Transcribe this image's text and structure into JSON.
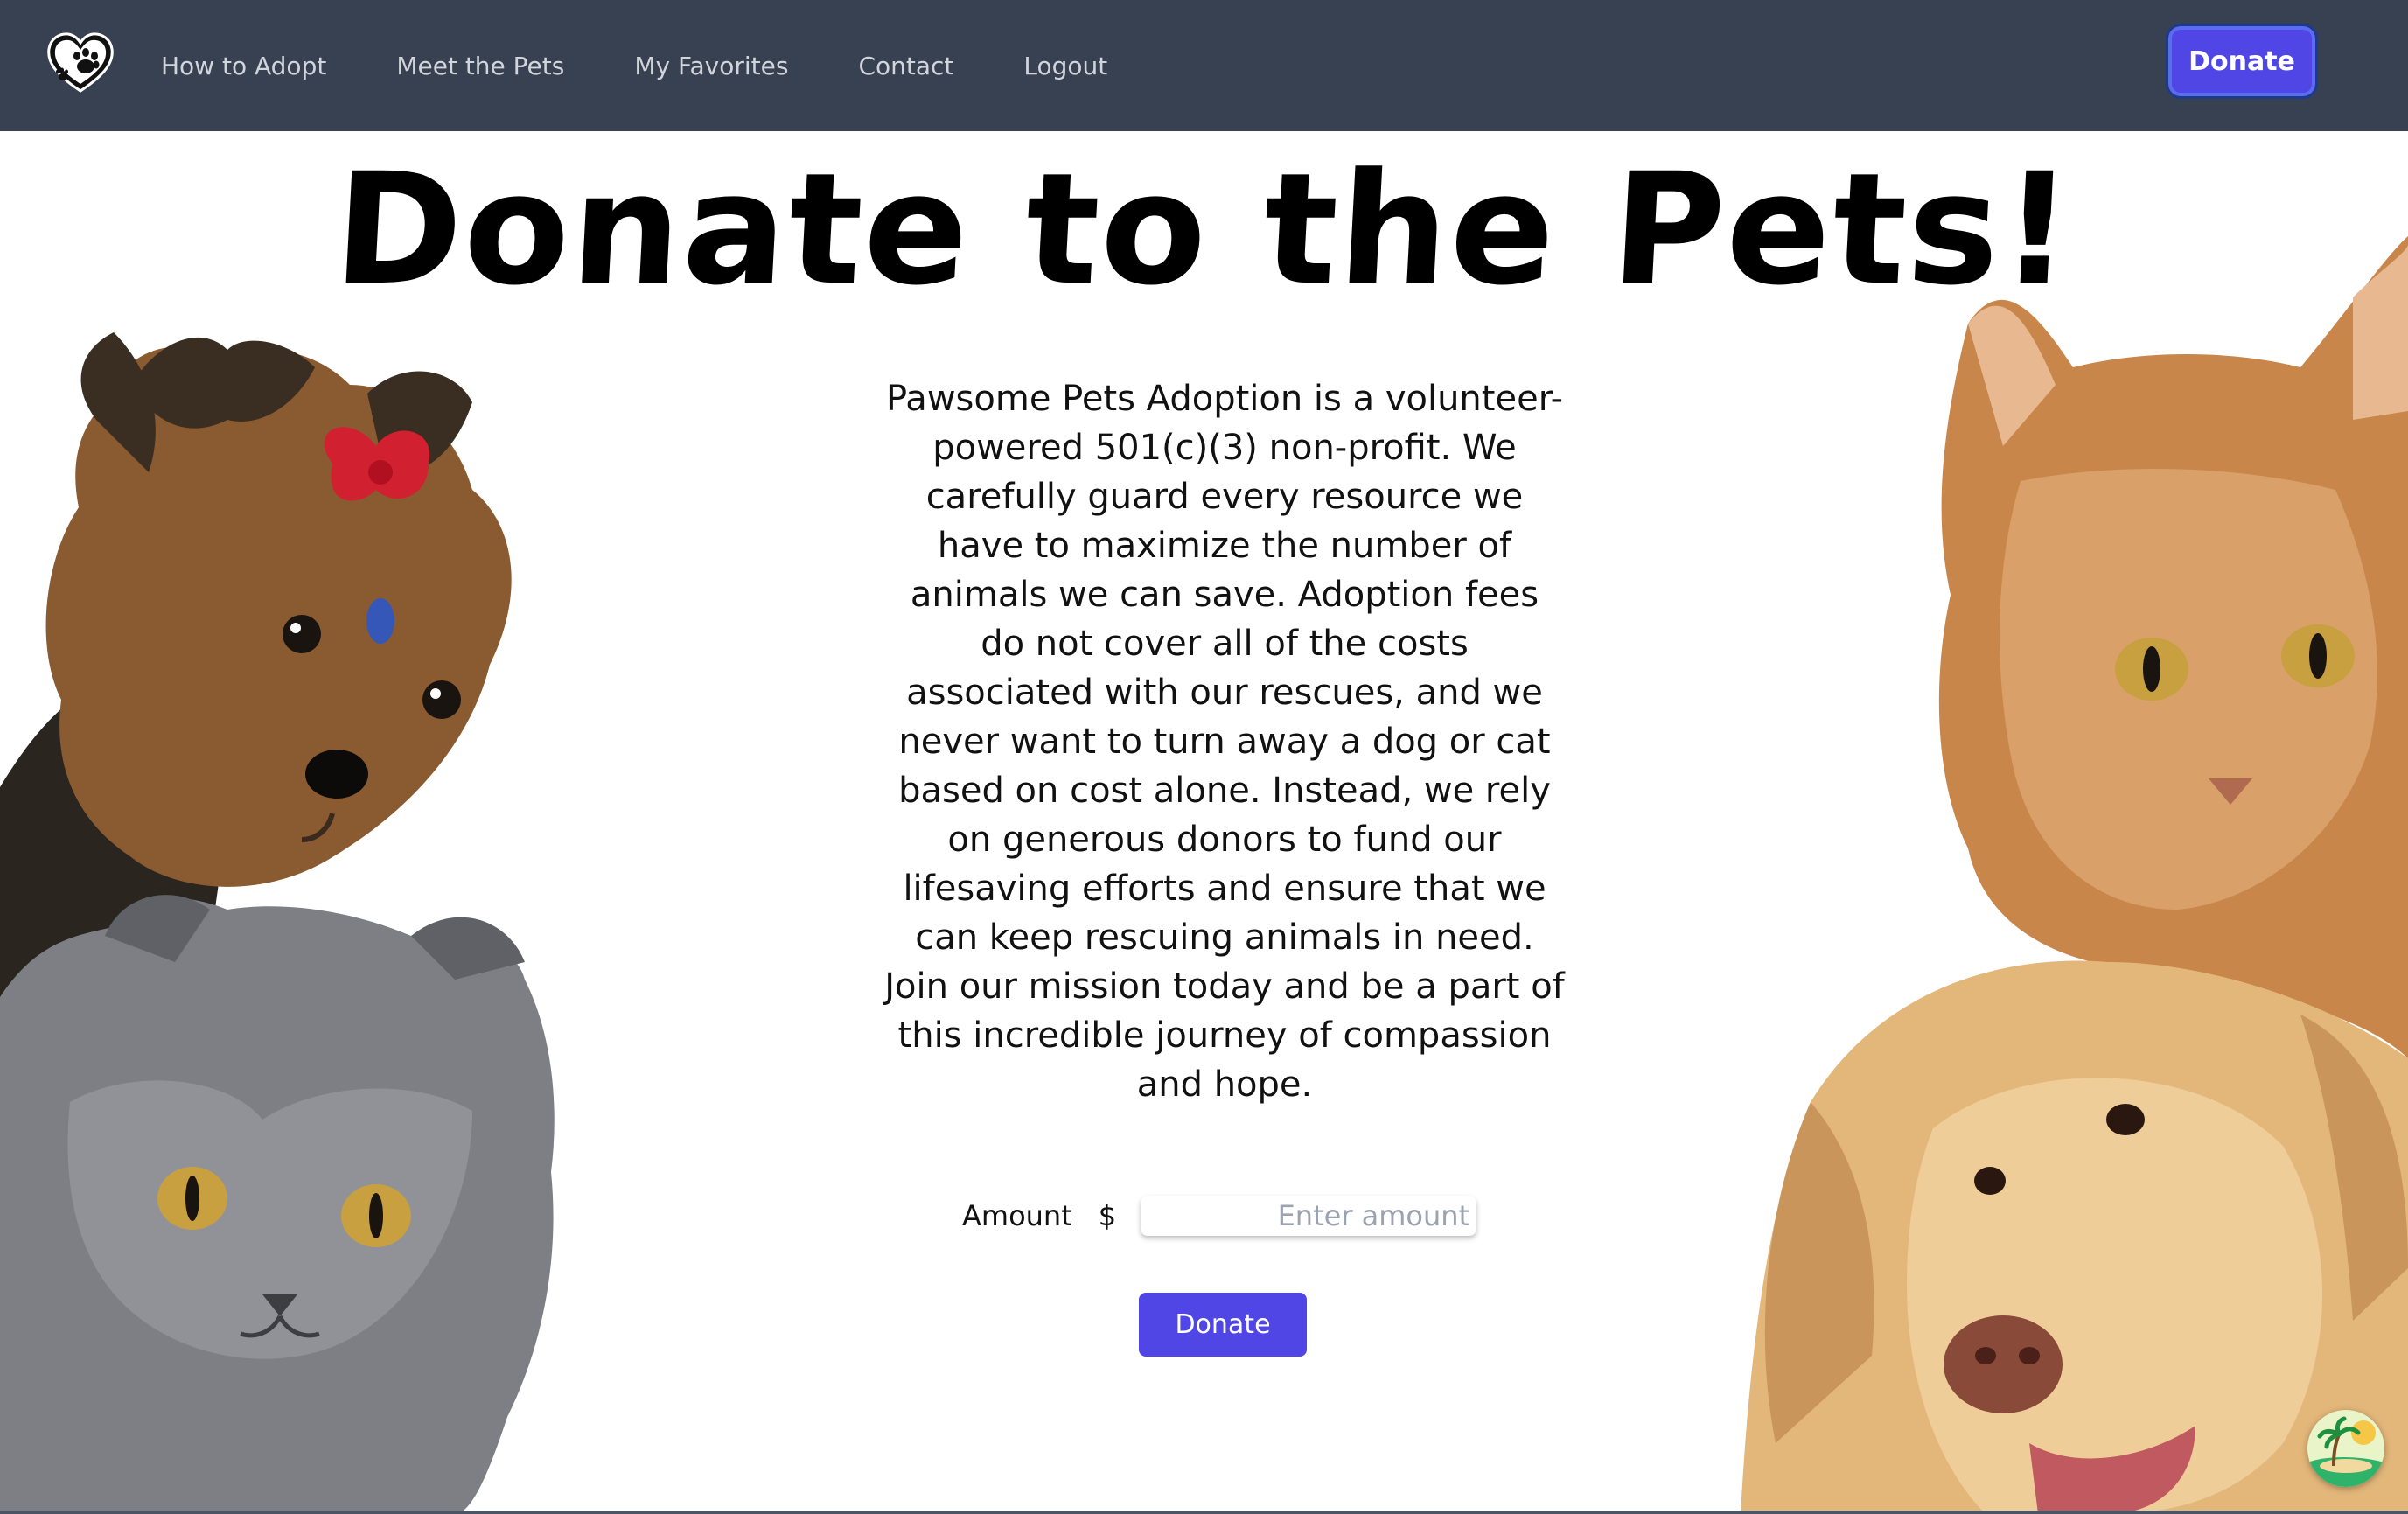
{
  "nav": {
    "logo_icon": "heart-paw-icon",
    "links": [
      "How to Adopt",
      "Meet the Pets",
      "My Favorites",
      "Contact",
      "Logout"
    ],
    "donate_label": "Donate"
  },
  "hero": {
    "title": "Donate to the Pets!"
  },
  "mission": {
    "text": "Pawsome Pets Adoption is a volunteer-powered 501(c)(3) non-profit. We carefully guard every resource we have to maximize the number of animals we can save. Adoption fees do not cover all of the costs associated with our rescues, and we never want to turn away a dog or cat based on cost alone. Instead, we rely on generous donors to fund our lifesaving efforts and ensure that we can keep rescuing animals in need. Join our mission today and be a part of this incredible journey of compassion and hope."
  },
  "form": {
    "amount_label": "Amount",
    "currency_symbol": "$",
    "amount_placeholder": "Enter amount",
    "amount_value": "",
    "submit_label": "Donate"
  },
  "colors": {
    "navbar_bg": "#374151",
    "nav_text": "#d1d5db",
    "accent": "#4f46e5"
  },
  "badge_icon": "island-badge-icon"
}
